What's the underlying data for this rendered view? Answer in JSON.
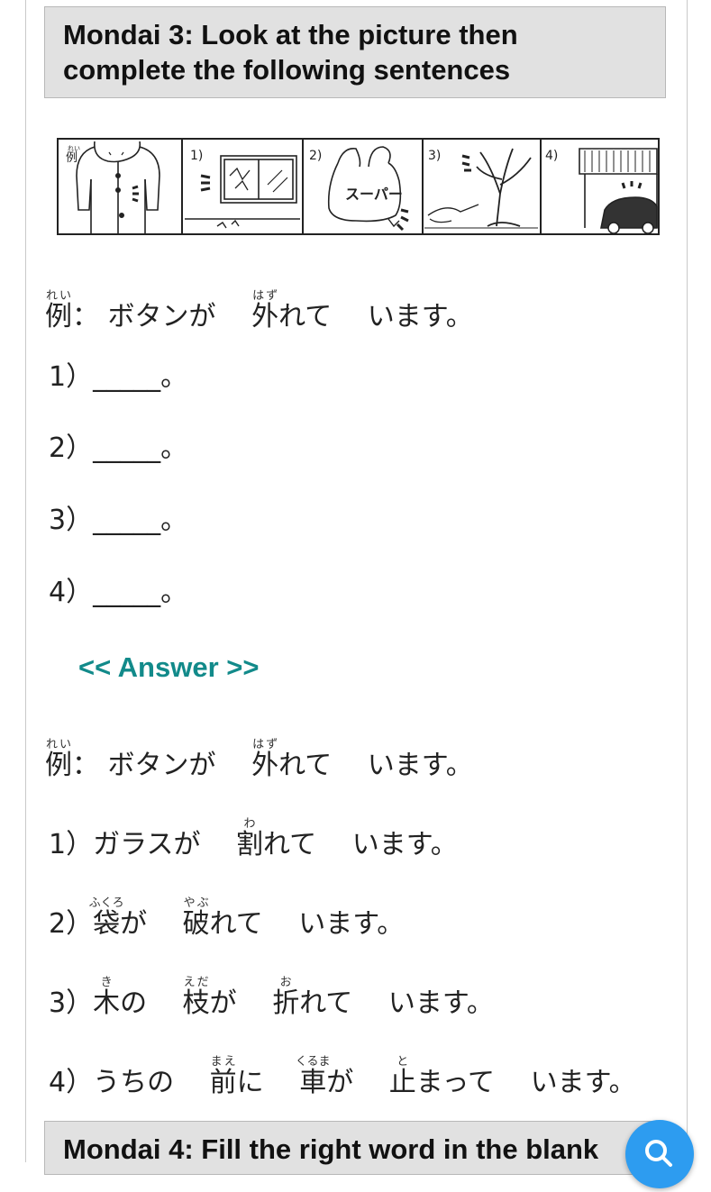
{
  "mondai3": {
    "title": "Mondai 3: Look at the picture then complete the following sentences"
  },
  "pictures": {
    "labels": [
      "例",
      "1)",
      "2)",
      "3)",
      "4)"
    ],
    "ruby_rei": "れい",
    "bag_text": "スーパー"
  },
  "questions": [
    {
      "prefix": "1）",
      "blank": "_____。"
    },
    {
      "prefix": "2）",
      "blank": "_____。"
    },
    {
      "prefix": "3）",
      "blank": "_____。"
    },
    {
      "prefix": "4）",
      "blank": "_____。"
    }
  ],
  "example": {
    "label": "例",
    "label_ruby": "れい",
    "colon": "：",
    "w1": "ボタンが",
    "w2_kanji": "外",
    "w2_ruby": "はず",
    "w2_rest": "れて",
    "w3": "います。"
  },
  "answer_link": "<< Answer >>",
  "answers": {
    "a1": {
      "prefix": "1）",
      "w1": "ガラスが",
      "w2_kanji": "割",
      "w2_ruby": "わ",
      "w2_rest": "れて",
      "w3": "います。"
    },
    "a2": {
      "prefix": "2）",
      "w1_kanji": "袋",
      "w1_ruby": "ふくろ",
      "w1_rest": "が",
      "w2_kanji": "破",
      "w2_ruby": "やぶ",
      "w2_rest": "れて",
      "w3": "います。"
    },
    "a3": {
      "prefix": "3）",
      "w1_kanji": "木",
      "w1_ruby": "き",
      "w1_rest": "の",
      "w2_kanji": "枝",
      "w2_ruby": "えだ",
      "w2_rest": "が",
      "w3_kanji": "折",
      "w3_ruby": "お",
      "w3_rest": "れて",
      "w4": "います。"
    },
    "a4": {
      "prefix": "4）",
      "w1": "うちの",
      "w2_kanji": "前",
      "w2_ruby": "まえ",
      "w2_rest": "に",
      "w3_kanji": "車",
      "w3_ruby": "くるま",
      "w3_rest": "が",
      "w4_kanji": "止",
      "w4_ruby": "と",
      "w4_rest": "まって",
      "w5": "います。"
    }
  },
  "mondai4": {
    "title": "Mondai 4: Fill the right word in the blank"
  },
  "fab_icon": "search-icon",
  "colors": {
    "answer_link": "#128a8a",
    "fab": "#2d9cf0",
    "heading_bg": "#e1e1e1"
  }
}
